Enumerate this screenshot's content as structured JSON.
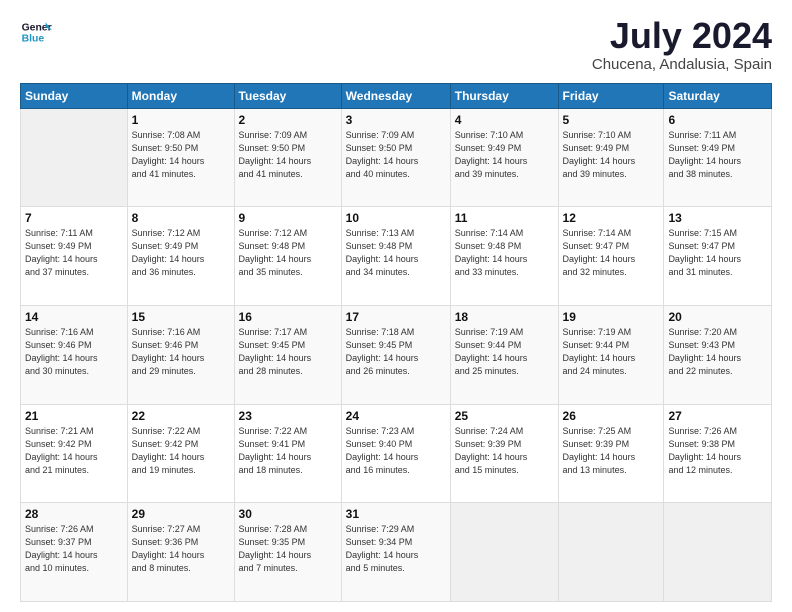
{
  "logo": {
    "line1": "General",
    "line2": "Blue"
  },
  "title": "July 2024",
  "subtitle": "Chucena, Andalusia, Spain",
  "headers": [
    "Sunday",
    "Monday",
    "Tuesday",
    "Wednesday",
    "Thursday",
    "Friday",
    "Saturday"
  ],
  "weeks": [
    [
      {
        "day": "",
        "info": ""
      },
      {
        "day": "1",
        "info": "Sunrise: 7:08 AM\nSunset: 9:50 PM\nDaylight: 14 hours\nand 41 minutes."
      },
      {
        "day": "2",
        "info": "Sunrise: 7:09 AM\nSunset: 9:50 PM\nDaylight: 14 hours\nand 41 minutes."
      },
      {
        "day": "3",
        "info": "Sunrise: 7:09 AM\nSunset: 9:50 PM\nDaylight: 14 hours\nand 40 minutes."
      },
      {
        "day": "4",
        "info": "Sunrise: 7:10 AM\nSunset: 9:49 PM\nDaylight: 14 hours\nand 39 minutes."
      },
      {
        "day": "5",
        "info": "Sunrise: 7:10 AM\nSunset: 9:49 PM\nDaylight: 14 hours\nand 39 minutes."
      },
      {
        "day": "6",
        "info": "Sunrise: 7:11 AM\nSunset: 9:49 PM\nDaylight: 14 hours\nand 38 minutes."
      }
    ],
    [
      {
        "day": "7",
        "info": "Sunrise: 7:11 AM\nSunset: 9:49 PM\nDaylight: 14 hours\nand 37 minutes."
      },
      {
        "day": "8",
        "info": "Sunrise: 7:12 AM\nSunset: 9:49 PM\nDaylight: 14 hours\nand 36 minutes."
      },
      {
        "day": "9",
        "info": "Sunrise: 7:12 AM\nSunset: 9:48 PM\nDaylight: 14 hours\nand 35 minutes."
      },
      {
        "day": "10",
        "info": "Sunrise: 7:13 AM\nSunset: 9:48 PM\nDaylight: 14 hours\nand 34 minutes."
      },
      {
        "day": "11",
        "info": "Sunrise: 7:14 AM\nSunset: 9:48 PM\nDaylight: 14 hours\nand 33 minutes."
      },
      {
        "day": "12",
        "info": "Sunrise: 7:14 AM\nSunset: 9:47 PM\nDaylight: 14 hours\nand 32 minutes."
      },
      {
        "day": "13",
        "info": "Sunrise: 7:15 AM\nSunset: 9:47 PM\nDaylight: 14 hours\nand 31 minutes."
      }
    ],
    [
      {
        "day": "14",
        "info": "Sunrise: 7:16 AM\nSunset: 9:46 PM\nDaylight: 14 hours\nand 30 minutes."
      },
      {
        "day": "15",
        "info": "Sunrise: 7:16 AM\nSunset: 9:46 PM\nDaylight: 14 hours\nand 29 minutes."
      },
      {
        "day": "16",
        "info": "Sunrise: 7:17 AM\nSunset: 9:45 PM\nDaylight: 14 hours\nand 28 minutes."
      },
      {
        "day": "17",
        "info": "Sunrise: 7:18 AM\nSunset: 9:45 PM\nDaylight: 14 hours\nand 26 minutes."
      },
      {
        "day": "18",
        "info": "Sunrise: 7:19 AM\nSunset: 9:44 PM\nDaylight: 14 hours\nand 25 minutes."
      },
      {
        "day": "19",
        "info": "Sunrise: 7:19 AM\nSunset: 9:44 PM\nDaylight: 14 hours\nand 24 minutes."
      },
      {
        "day": "20",
        "info": "Sunrise: 7:20 AM\nSunset: 9:43 PM\nDaylight: 14 hours\nand 22 minutes."
      }
    ],
    [
      {
        "day": "21",
        "info": "Sunrise: 7:21 AM\nSunset: 9:42 PM\nDaylight: 14 hours\nand 21 minutes."
      },
      {
        "day": "22",
        "info": "Sunrise: 7:22 AM\nSunset: 9:42 PM\nDaylight: 14 hours\nand 19 minutes."
      },
      {
        "day": "23",
        "info": "Sunrise: 7:22 AM\nSunset: 9:41 PM\nDaylight: 14 hours\nand 18 minutes."
      },
      {
        "day": "24",
        "info": "Sunrise: 7:23 AM\nSunset: 9:40 PM\nDaylight: 14 hours\nand 16 minutes."
      },
      {
        "day": "25",
        "info": "Sunrise: 7:24 AM\nSunset: 9:39 PM\nDaylight: 14 hours\nand 15 minutes."
      },
      {
        "day": "26",
        "info": "Sunrise: 7:25 AM\nSunset: 9:39 PM\nDaylight: 14 hours\nand 13 minutes."
      },
      {
        "day": "27",
        "info": "Sunrise: 7:26 AM\nSunset: 9:38 PM\nDaylight: 14 hours\nand 12 minutes."
      }
    ],
    [
      {
        "day": "28",
        "info": "Sunrise: 7:26 AM\nSunset: 9:37 PM\nDaylight: 14 hours\nand 10 minutes."
      },
      {
        "day": "29",
        "info": "Sunrise: 7:27 AM\nSunset: 9:36 PM\nDaylight: 14 hours\nand 8 minutes."
      },
      {
        "day": "30",
        "info": "Sunrise: 7:28 AM\nSunset: 9:35 PM\nDaylight: 14 hours\nand 7 minutes."
      },
      {
        "day": "31",
        "info": "Sunrise: 7:29 AM\nSunset: 9:34 PM\nDaylight: 14 hours\nand 5 minutes."
      },
      {
        "day": "",
        "info": ""
      },
      {
        "day": "",
        "info": ""
      },
      {
        "day": "",
        "info": ""
      }
    ]
  ]
}
